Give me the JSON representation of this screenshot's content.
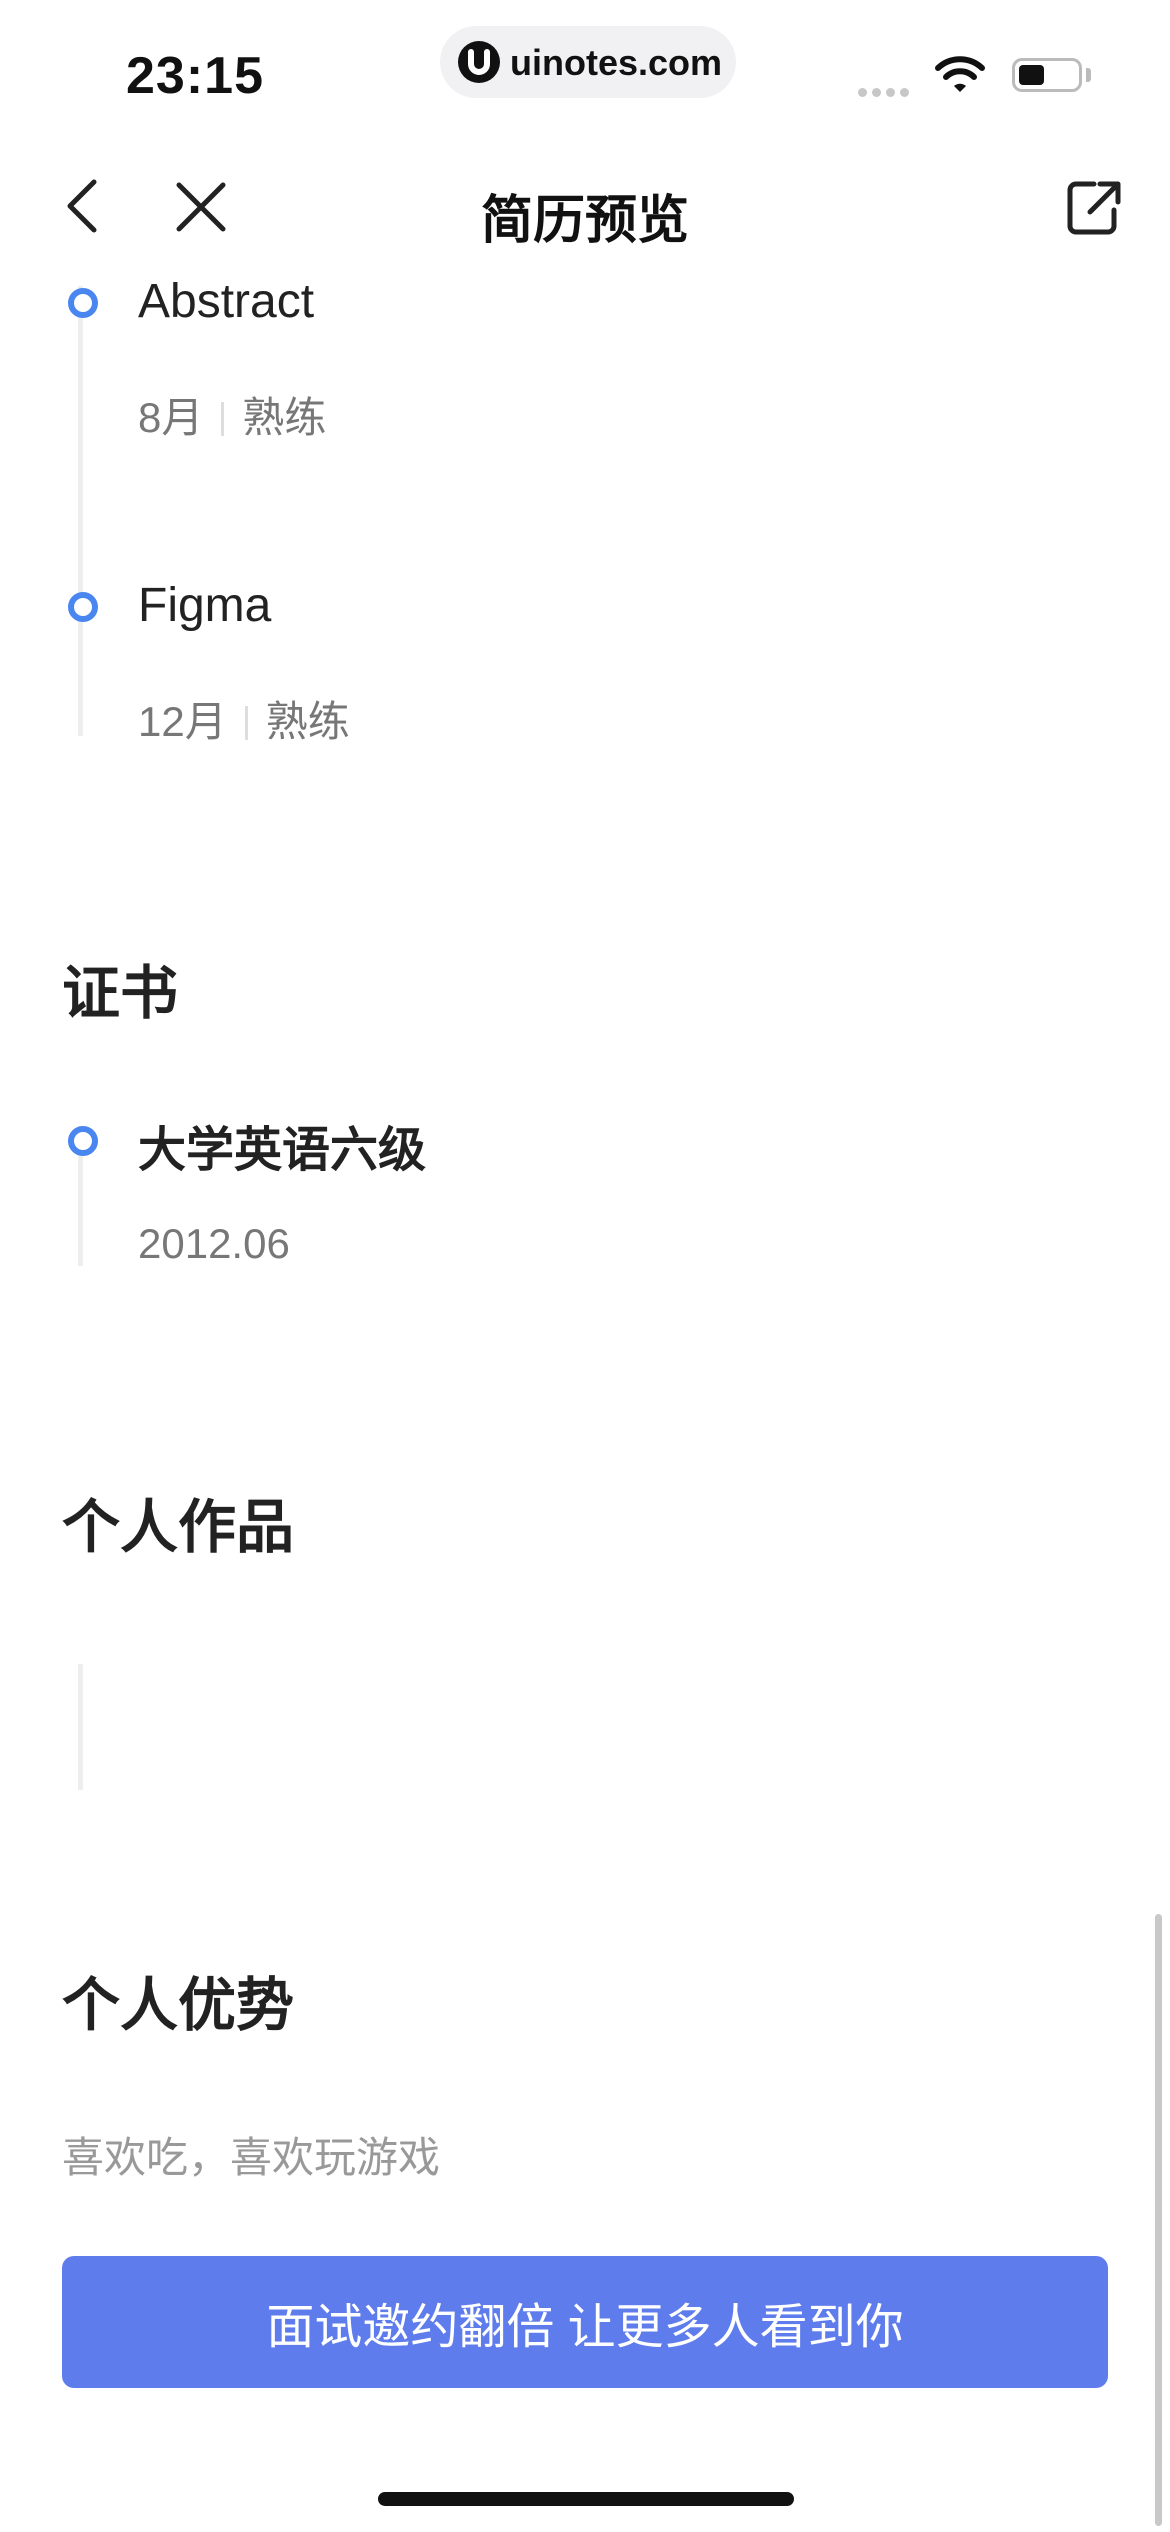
{
  "status_bar": {
    "time": "23:15",
    "url": "uinotes.com"
  },
  "nav": {
    "title": "简历预览",
    "back_icon": "chevron-left-icon",
    "close_icon": "close-icon",
    "share_icon": "share-icon"
  },
  "skills": [
    {
      "name": "Abstract",
      "duration": "8月",
      "level": "熟练"
    },
    {
      "name": "Figma",
      "duration": "12月",
      "level": "熟练"
    }
  ],
  "certificates": {
    "title": "证书",
    "items": [
      {
        "name": "大学英语六级",
        "date": "2012.06"
      }
    ]
  },
  "works": {
    "title": "个人作品"
  },
  "advantages": {
    "title": "个人优势",
    "text": "喜欢吃，喜欢玩游戏"
  },
  "cta": {
    "label": "面试邀约翻倍 让更多人看到你"
  },
  "colors": {
    "accent": "#5f7ced",
    "timeline_dot": "#4a86f0"
  },
  "battery_level": 0.45
}
